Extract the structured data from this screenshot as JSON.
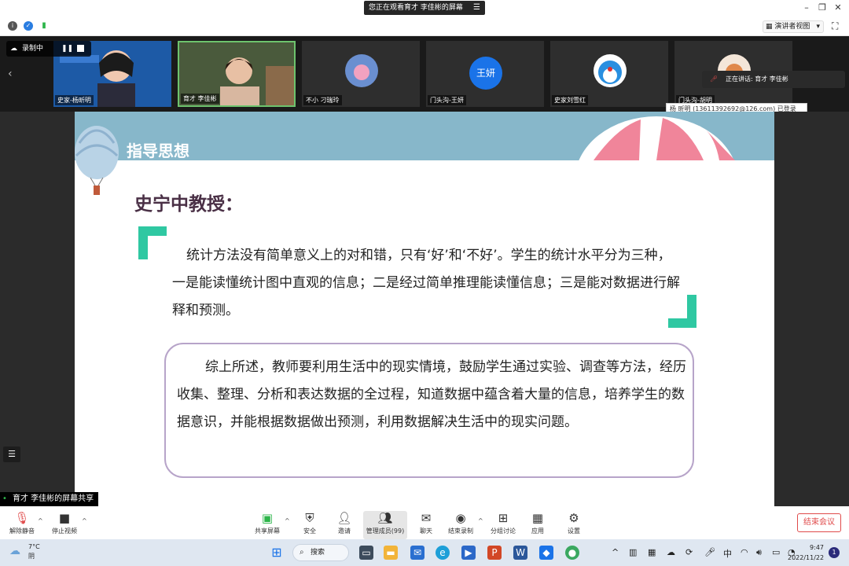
{
  "window": {
    "share_banner": "您正在观看育才 李佳彬的屏幕",
    "speaker_view_label": "演讲者视图",
    "speaker_view_caret": "▾"
  },
  "recording": {
    "label": "录制中"
  },
  "video_strip": {
    "tiles": [
      {
        "name": "史家-杨昕明",
        "avatar": ""
      },
      {
        "name": "育才 李佳彬",
        "avatar": ""
      },
      {
        "name": "不小 刁瑞玲",
        "avatar": ""
      },
      {
        "name": "门头沟-王妍",
        "avatar": "王妍"
      },
      {
        "name": "史家刘雪红",
        "avatar": ""
      },
      {
        "name": "门头沟-胡明",
        "avatar": ""
      }
    ],
    "speaking": "正在讲话: 育才 李佳彬",
    "tooltip": "杨 昕明 (13611392692@126.com) 已登录"
  },
  "slide": {
    "title": "指导思想",
    "professor": "史宁中教授：",
    "quote": "统计方法没有简单意义上的对和错，只有‘好’和‘不好’。学生的统计水平分为三种，一是能读懂统计图中直观的信息；二是经过简单推理能读懂信息；三是能对数据进行解释和预测。",
    "summary": "综上所述，教师要利用生活中的现实情境，鼓励学生通过实验、调查等方法，经历收集、整理、分析和表达数据的全过程，知道数据中蕴含着大量的信息，培养学生的数据意识，并能根据数据做出预测，利用数据解决生活中的现实问题。"
  },
  "share_label": "育才 李佳彬的屏幕共享",
  "toolbar": {
    "unmute": "解除静音",
    "stop_video": "停止视频",
    "share_screen": "共享屏幕",
    "security": "安全",
    "invite": "邀请",
    "manage_members": "管理成员(99)",
    "chat": "聊天",
    "end_recording": "结束录制",
    "breakout": "分组讨论",
    "apps": "应用",
    "settings": "设置",
    "end_meeting": "结束会议"
  },
  "taskbar": {
    "temperature": "7°C",
    "weather": "阴",
    "search": "搜索",
    "ime": "中",
    "time": "9:47",
    "date": "2022/11/22",
    "notifications": "1"
  },
  "colors": {
    "slide_header": "#87b7ca",
    "quote_mark": "#2fc8a2",
    "summary_border": "#b7a4c9",
    "end_meeting": "#e04b4b"
  }
}
